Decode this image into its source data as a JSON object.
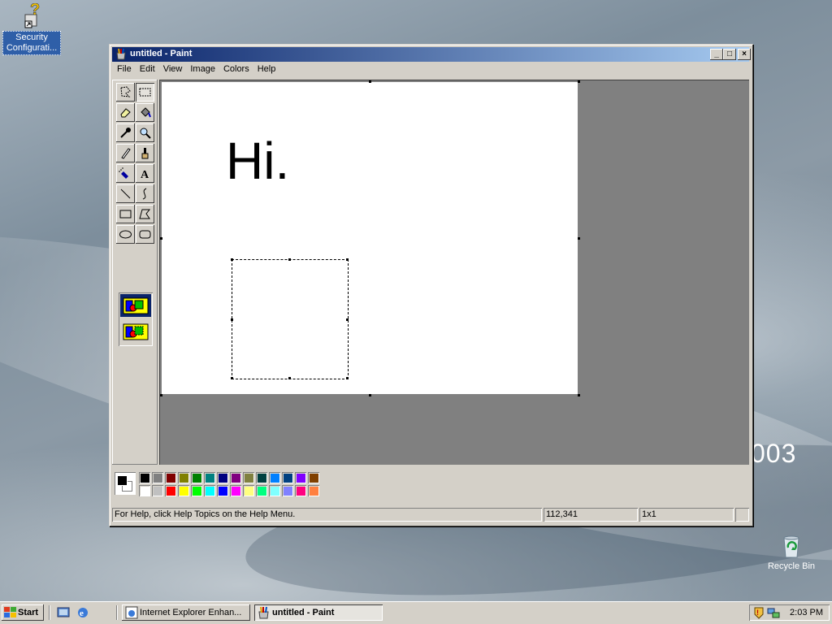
{
  "desktop": {
    "brand_fragment": "003",
    "icons": [
      {
        "label": "Security Configurati...",
        "icon": "security-config-help-icon"
      },
      {
        "label": "Recycle Bin",
        "icon": "recycle-bin-icon"
      }
    ]
  },
  "window": {
    "title": "untitled - Paint",
    "controls": {
      "minimize": "_",
      "maximize": "□",
      "close": "×"
    }
  },
  "menu": [
    "File",
    "Edit",
    "View",
    "Image",
    "Colors",
    "Help"
  ],
  "tools": [
    "free-form-select-icon",
    "rect-select-icon",
    "eraser-icon",
    "fill-icon",
    "pick-color-icon",
    "magnifier-icon",
    "pencil-icon",
    "brush-icon",
    "airbrush-icon",
    "text-icon",
    "line-icon",
    "curve-icon",
    "rectangle-icon",
    "polygon-icon",
    "ellipse-icon",
    "rounded-rect-icon"
  ],
  "active_tool": "rect-select-icon",
  "canvas": {
    "text": "Hi."
  },
  "colors": {
    "foreground": "#000000",
    "background": "#ffffff",
    "palette_top": [
      "#000000",
      "#808080",
      "#800000",
      "#808000",
      "#008000",
      "#008080",
      "#000080",
      "#800080",
      "#808040",
      "#004040",
      "#0080ff",
      "#004080",
      "#8000ff",
      "#804000"
    ],
    "palette_bottom": [
      "#ffffff",
      "#c0c0c0",
      "#ff0000",
      "#ffff00",
      "#00ff00",
      "#00ffff",
      "#0000ff",
      "#ff00ff",
      "#ffff80",
      "#00ff80",
      "#80ffff",
      "#8080ff",
      "#ff0080",
      "#ff8040"
    ]
  },
  "status": {
    "help": "For Help, click Help Topics on the Help Menu.",
    "coords": "112,341",
    "size": "1x1"
  },
  "taskbar": {
    "start": "Start",
    "buttons": [
      {
        "label": "Internet Explorer Enhan...",
        "active": false
      },
      {
        "label": "untitled - Paint",
        "active": true
      }
    ],
    "clock": "2:03 PM"
  }
}
